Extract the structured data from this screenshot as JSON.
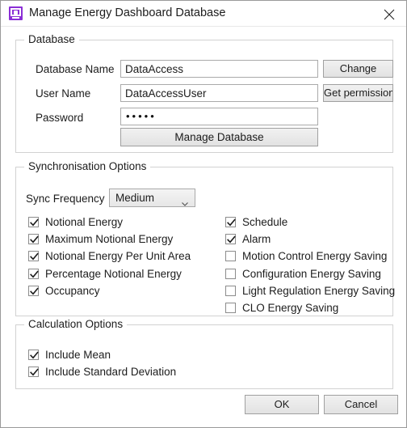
{
  "window": {
    "title": "Manage Energy Dashboard Database",
    "icon": "monitor-icon",
    "close_label": "✕",
    "accent_color": "#8b2fd6"
  },
  "database_group": {
    "legend": "Database",
    "fields": [
      {
        "label": "Database Name",
        "value": "DataAccess"
      },
      {
        "label": "User Name",
        "value": "DataAccessUser"
      },
      {
        "label": "Password",
        "value": "•••••"
      }
    ],
    "change_button": "Change",
    "get_permission_button": "Get permission",
    "manage_database_button": "Manage Database"
  },
  "sync_group": {
    "legend": "Synchronisation Options",
    "frequency_label": "Sync Frequency",
    "frequency_value": "Medium",
    "left_options": [
      {
        "label": "Notional Energy",
        "checked": true
      },
      {
        "label": "Maximum Notional Energy",
        "checked": true
      },
      {
        "label": "Notional Energy Per Unit Area",
        "checked": true
      },
      {
        "label": "Percentage Notional Energy",
        "checked": true
      },
      {
        "label": "Occupancy",
        "checked": true
      }
    ],
    "right_options": [
      {
        "label": "Schedule",
        "checked": true
      },
      {
        "label": "Alarm",
        "checked": true
      },
      {
        "label": "Motion Control Energy Saving",
        "checked": false
      },
      {
        "label": "Configuration Energy Saving",
        "checked": false
      },
      {
        "label": "Light Regulation Energy Saving",
        "checked": false
      },
      {
        "label": "CLO Energy Saving",
        "checked": false
      }
    ]
  },
  "calc_group": {
    "legend": "Calculation Options",
    "options": [
      {
        "label": "Include Mean",
        "checked": true
      },
      {
        "label": "Include Standard Deviation",
        "checked": true
      }
    ]
  },
  "footer": {
    "ok_label": "OK",
    "cancel_label": "Cancel"
  }
}
